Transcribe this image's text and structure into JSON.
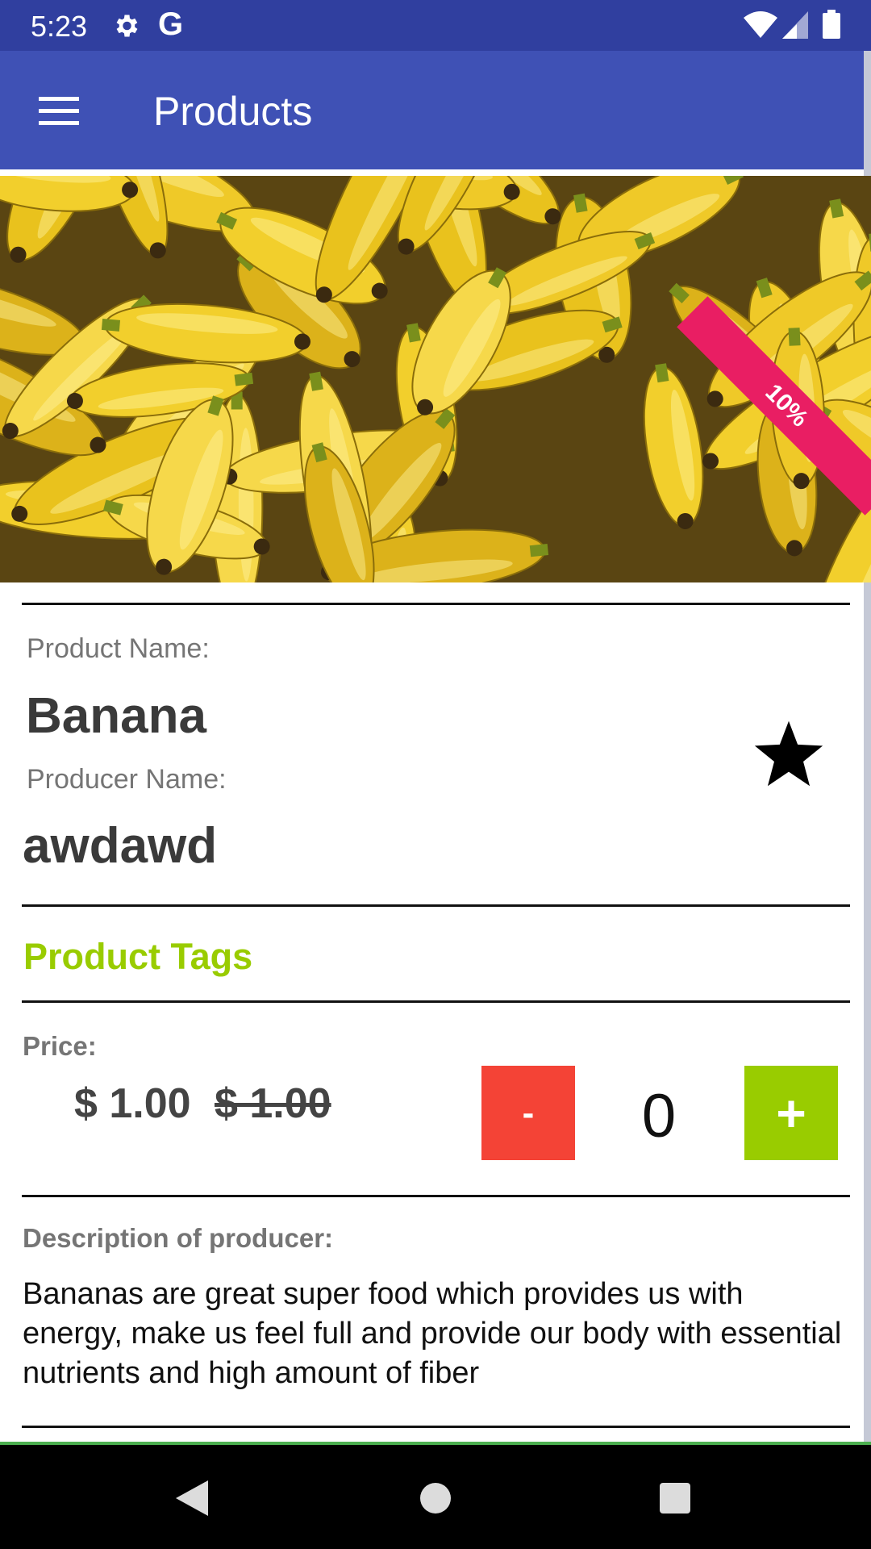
{
  "status_bar": {
    "time": "5:23",
    "g_label": "G",
    "icons": [
      "gear-icon",
      "wifi-icon",
      "signal-icon",
      "battery-icon"
    ]
  },
  "app_bar": {
    "title": "Products",
    "menu_icon": "menu-icon",
    "background": "#3f51b5"
  },
  "hero": {
    "image": "bananas-photo",
    "discount_badge": "10%",
    "badge_color": "#e91e63"
  },
  "product": {
    "name_label": "Product Name:",
    "name": "Banana",
    "producer_label": "Producer Name:",
    "producer": "awdawd",
    "favorite_icon": "star-icon"
  },
  "tags": {
    "title": "Product Tags",
    "color": "#99cc00"
  },
  "price": {
    "label": "Price:",
    "current": "$ 1.00",
    "original": "$ 1.00"
  },
  "quantity": {
    "minus_label": "-",
    "value": "0",
    "plus_label": "+",
    "minus_color": "#f44336",
    "plus_color": "#99cc00"
  },
  "description": {
    "label": "Description of producer:",
    "text": "Bananas are great super food which provides us with energy, make us feel full and provide our body with essential nutrients and high amount of fiber"
  },
  "nav_bar": {
    "icons": [
      "back-icon",
      "home-icon",
      "recents-icon"
    ]
  }
}
